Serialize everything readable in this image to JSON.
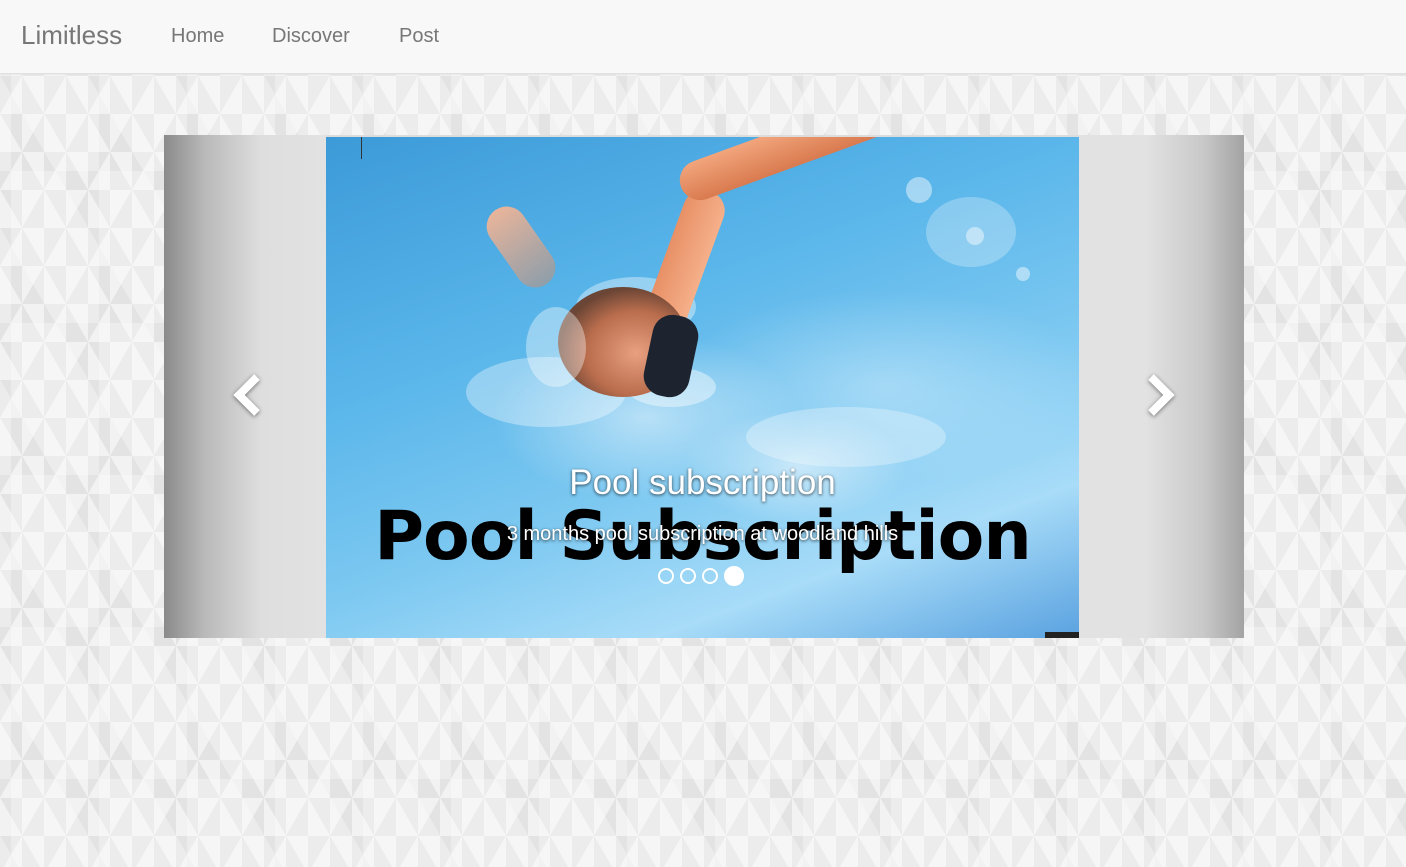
{
  "navbar": {
    "brand": "Limitless",
    "links": [
      {
        "label": "Home"
      },
      {
        "label": "Discover"
      },
      {
        "label": "Post"
      }
    ]
  },
  "carousel": {
    "slide": {
      "image_text": "Pool Subscription",
      "caption_title": "Pool subscription",
      "caption_text": "3 months pool subscription at woodland hills"
    },
    "indicators": {
      "count": 4,
      "active_index": 3
    },
    "prev_icon": "chevron-left-icon",
    "next_icon": "chevron-right-icon"
  }
}
